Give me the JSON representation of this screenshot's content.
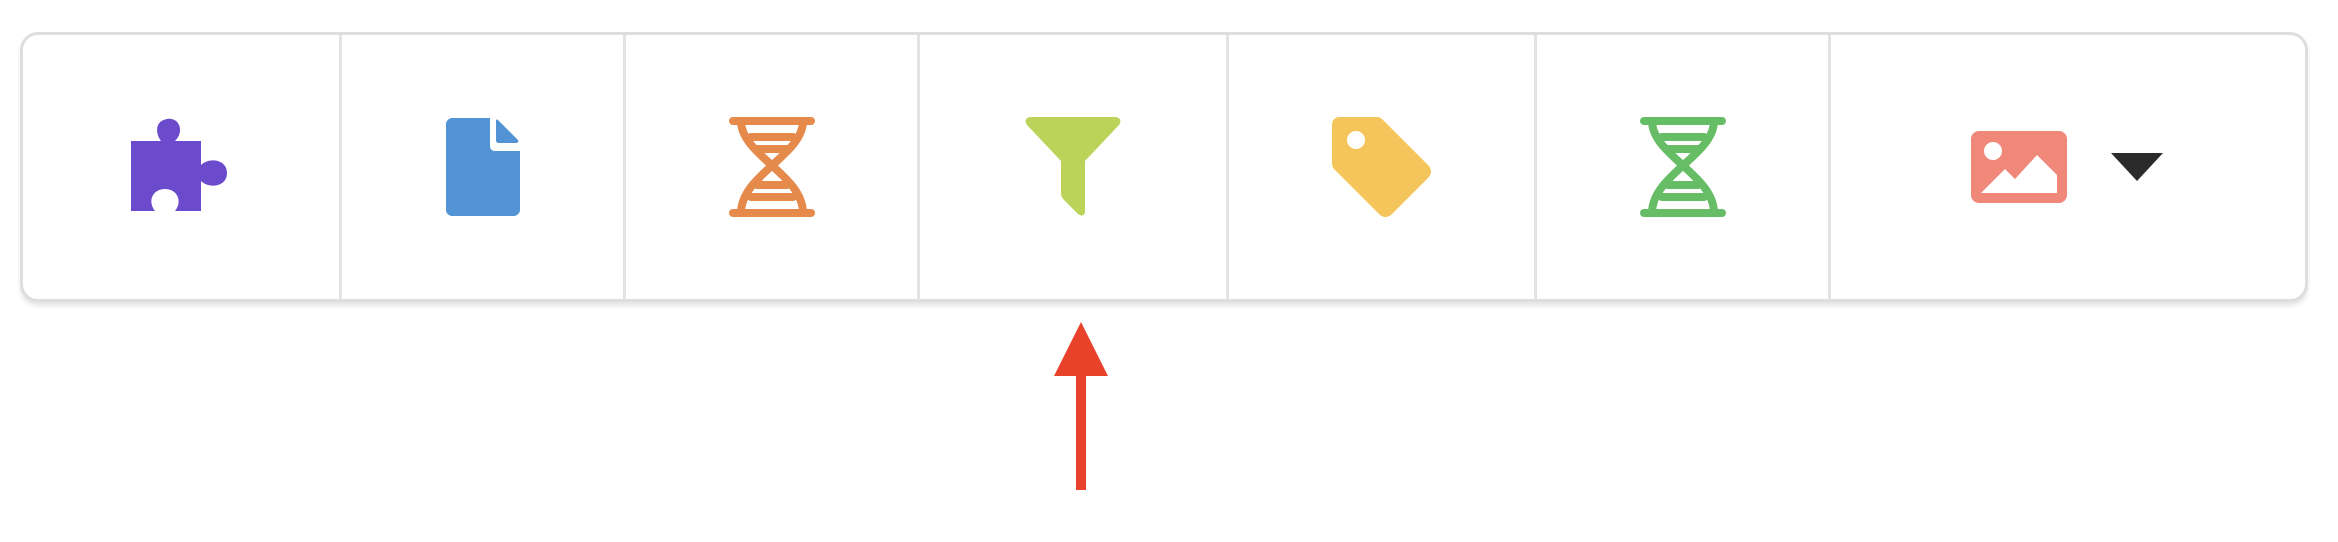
{
  "toolbar": {
    "tools": [
      {
        "icon": "puzzle-piece-icon",
        "color": "#6b4bcc"
      },
      {
        "icon": "file-icon",
        "color": "#5193d4"
      },
      {
        "icon": "dna-icon",
        "color": "#e58a4b"
      },
      {
        "icon": "filter-icon",
        "color": "#bcd35a"
      },
      {
        "icon": "tag-icon",
        "color": "#f4c55a"
      },
      {
        "icon": "dna-icon",
        "color": "#66bd66"
      },
      {
        "icon": "image-icon",
        "color": "#ef8878",
        "has_dropdown": true
      }
    ],
    "dropdown_icon": "caret-down-icon"
  },
  "annotation": {
    "icon": "up-arrow-icon",
    "color": "#e8432a",
    "points_to": "filter-icon"
  }
}
